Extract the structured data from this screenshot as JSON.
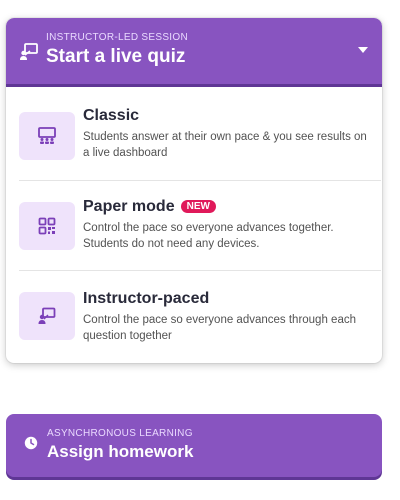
{
  "live": {
    "subtitle": "INSTRUCTOR-LED SESSION",
    "title": "Start a live quiz",
    "icon": "presentation-icon"
  },
  "options": [
    {
      "title": "Classic",
      "description": "Students answer at their own pace & you see results on a live dashboard",
      "icon": "classroom-icon"
    },
    {
      "title": "Paper mode",
      "badge": "NEW",
      "description": "Control the pace so everyone advances together. Students do not need any devices.",
      "icon": "qr-code-icon"
    },
    {
      "title": "Instructor-paced",
      "description": "Control the pace so everyone advances through each question together",
      "icon": "presenter-icon"
    }
  ],
  "homework": {
    "subtitle": "ASYNCHRONOUS LEARNING",
    "title": "Assign homework",
    "icon": "clock-icon"
  },
  "colors": {
    "brand_purple": "#8854c0",
    "icon_bg": "#efe3fb",
    "badge_red": "#e0195a"
  }
}
